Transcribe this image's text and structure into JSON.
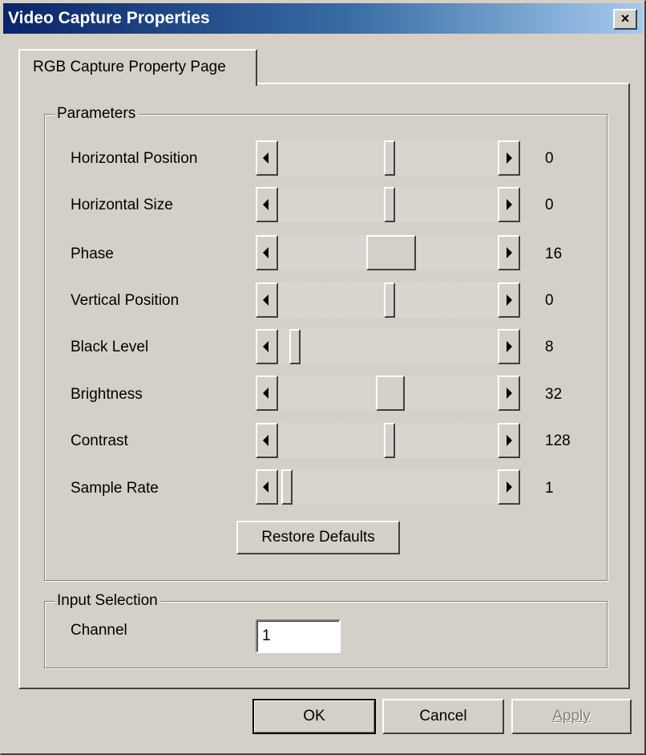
{
  "window": {
    "title": "Video Capture Properties",
    "close_label": "×"
  },
  "tabs": [
    {
      "label": "RGB Capture Property Page",
      "selected": true
    }
  ],
  "parameters": {
    "legend": "Parameters",
    "items": [
      {
        "label": "Horizontal Position",
        "value": "0"
      },
      {
        "label": "Horizontal Size",
        "value": "0"
      },
      {
        "label": "Phase",
        "value": "16"
      },
      {
        "label": "Vertical Position",
        "value": "0"
      },
      {
        "label": "Black Level",
        "value": "8"
      },
      {
        "label": "Brightness",
        "value": "32"
      },
      {
        "label": "Contrast",
        "value": "128"
      },
      {
        "label": "Sample Rate",
        "value": "1"
      }
    ],
    "restore_label": "Restore Defaults"
  },
  "input_selection": {
    "legend": "Input Selection",
    "channel_label": "Channel",
    "channel_value": "1"
  },
  "buttons": {
    "ok": "OK",
    "cancel": "Cancel",
    "apply": "Apply",
    "apply_enabled": false
  },
  "colors": {
    "face": "#d4d0c8",
    "title_start": "#0a246a",
    "title_end": "#a6caf0"
  }
}
